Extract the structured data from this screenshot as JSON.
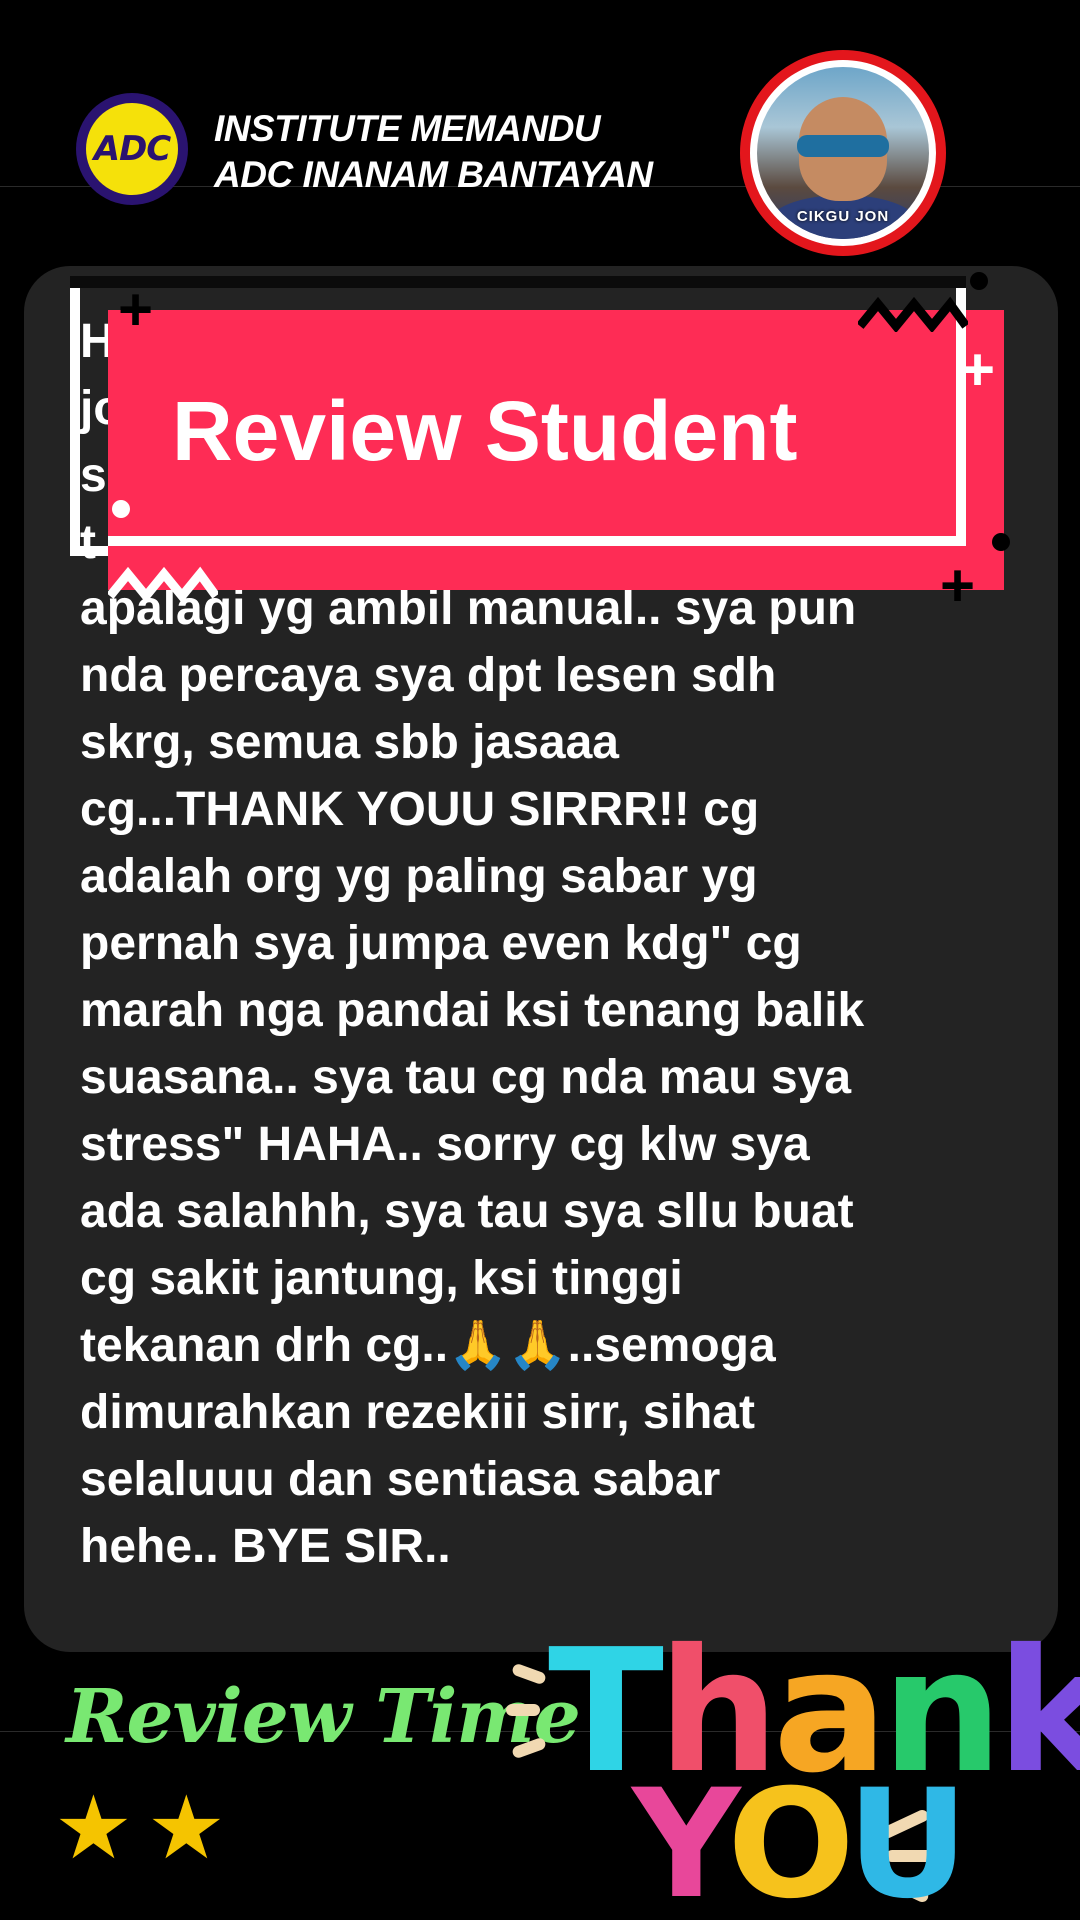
{
  "header": {
    "logo_text": "ADC",
    "brand_line1": "INSTITUTE MEMANDU",
    "brand_line2": "ADC INANAM BANTAYAN",
    "avatar_label": "CIKGU JON"
  },
  "banner": {
    "title": "Review Student"
  },
  "review": {
    "text": "apalagi yg ambil manual.. sya pun\nnda percaya sya dpt lesen sdh\nskrg, semua sbb jasaaa\ncg...THANK YOUU SIRRR!! cg\nadalah org yg paling sabar yg\npernah sya jumpa even kdg\" cg\nmarah nga pandai ksi tenang balik\nsuasana.. sya tau cg nda mau sya\nstress\" HAHA.. sorry cg klw sya\nada salahhh, sya tau sya sllu buat\ncg sakit jantung, ksi tinggi\ntekanan drh cg..🙏🙏..semoga\ndimurahkan rezekiii sirr, sihat\nselaluuu dan sentiasa sabar\nhehe.. BYE SIR..",
    "hidden_fragments": [
      "H",
      "jo",
      "s",
      "t"
    ]
  },
  "stickers": {
    "review_time": "Review Time",
    "thank_letters": [
      "T",
      "h",
      "a",
      "n",
      "k"
    ],
    "you_letters": [
      "Y",
      "O",
      "U"
    ],
    "thank_colors": [
      "#2fd4e6",
      "#f04f6a",
      "#f6a623",
      "#27c96b",
      "#7b4de0"
    ],
    "you_colors": [
      "#e8479a",
      "#f6c21c",
      "#2fb8e6"
    ],
    "stars": [
      "★",
      "★"
    ]
  },
  "colors": {
    "banner": "#fe2c55",
    "card": "#232323",
    "review_time": "#79e872",
    "avatar_ring": "#e3161c"
  }
}
